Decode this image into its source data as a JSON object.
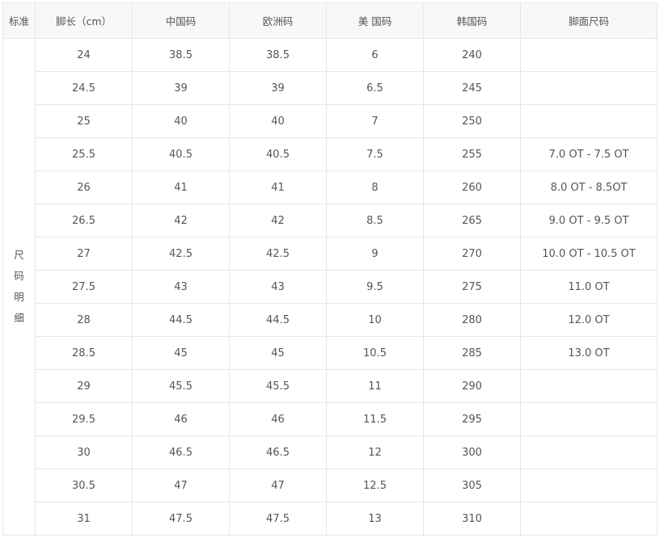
{
  "table": {
    "headers": [
      "标准",
      "脚长（cm）",
      "中国码",
      "欧洲码",
      "美 国码",
      "韩国码",
      "脚面尺码"
    ],
    "standard_label": [
      "尺",
      "码",
      "明",
      "细"
    ],
    "rows": [
      [
        "24",
        "38.5",
        "38.5",
        "6",
        "240",
        ""
      ],
      [
        "24.5",
        "39",
        "39",
        "6.5",
        "245",
        ""
      ],
      [
        "25",
        "40",
        "40",
        "7",
        "250",
        ""
      ],
      [
        "25.5",
        "40.5",
        "40.5",
        "7.5",
        "255",
        "7.0 OT - 7.5 OT"
      ],
      [
        "26",
        "41",
        "41",
        "8",
        "260",
        "8.0 OT - 8.5OT"
      ],
      [
        "26.5",
        "42",
        "42",
        "8.5",
        "265",
        "9.0 OT - 9.5 OT"
      ],
      [
        "27",
        "42.5",
        "42.5",
        "9",
        "270",
        "10.0 OT - 10.5 OT"
      ],
      [
        "27.5",
        "43",
        "43",
        "9.5",
        "275",
        "11.0 OT"
      ],
      [
        "28",
        "44.5",
        "44.5",
        "10",
        "280",
        "12.0 OT"
      ],
      [
        "28.5",
        "45",
        "45",
        "10.5",
        "285",
        "13.0 OT"
      ],
      [
        "29",
        "45.5",
        "45.5",
        "11",
        "290",
        ""
      ],
      [
        "29.5",
        "46",
        "46",
        "11.5",
        "295",
        ""
      ],
      [
        "30",
        "46.5",
        "46.5",
        "12",
        "300",
        ""
      ],
      [
        "30.5",
        "47",
        "47",
        "12.5",
        "305",
        ""
      ],
      [
        "31",
        "47.5",
        "47.5",
        "13",
        "310",
        ""
      ]
    ]
  }
}
